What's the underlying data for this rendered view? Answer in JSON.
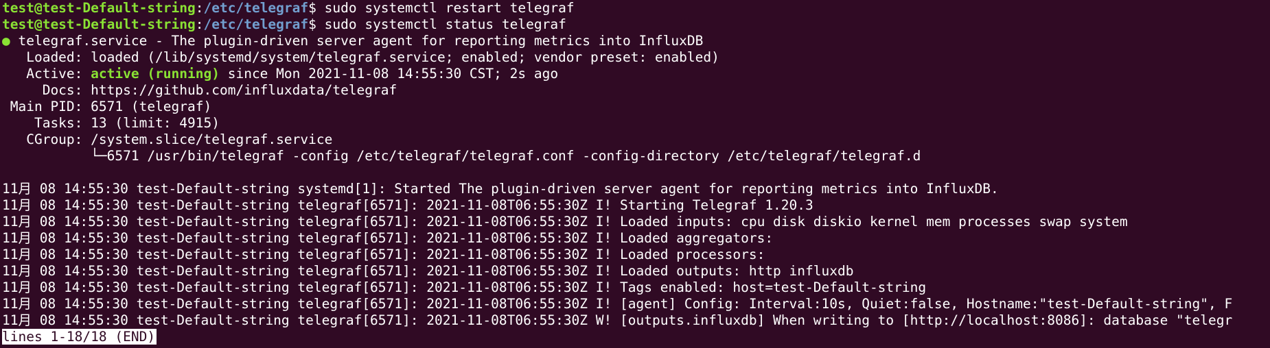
{
  "terminal": {
    "prompt_user": "test@test-Default-string",
    "prompt_sep": ":",
    "prompt_path": "/etc/telegraf",
    "prompt_symbol": "$ ",
    "commands": [
      "sudo systemctl restart telegraf",
      "sudo systemctl status telegraf"
    ],
    "status": {
      "bullet": "●",
      "header": " telegraf.service - The plugin-driven server agent for reporting metrics into InfluxDB",
      "loaded": "   Loaded: loaded (/lib/systemd/system/telegraf.service; enabled; vendor preset: enabled)",
      "active_label": "   Active: ",
      "active_state": "active (running)",
      "active_rest": " since Mon 2021-11-08 14:55:30 CST; 2s ago",
      "docs": "     Docs: https://github.com/influxdata/telegraf",
      "main_pid": " Main PID: 6571 (telegraf)",
      "tasks": "    Tasks: 13 (limit: 4915)",
      "cgroup": "   CGroup: /system.slice/telegraf.service",
      "cgroup_child": "           └─6571 /usr/bin/telegraf -config /etc/telegraf/telegraf.conf -config-directory /etc/telegraf/telegraf.d"
    },
    "log_lines": [
      "11月 08 14:55:30 test-Default-string systemd[1]: Started The plugin-driven server agent for reporting metrics into InfluxDB.",
      "11月 08 14:55:30 test-Default-string telegraf[6571]: 2021-11-08T06:55:30Z I! Starting Telegraf 1.20.3",
      "11月 08 14:55:30 test-Default-string telegraf[6571]: 2021-11-08T06:55:30Z I! Loaded inputs: cpu disk diskio kernel mem processes swap system",
      "11月 08 14:55:30 test-Default-string telegraf[6571]: 2021-11-08T06:55:30Z I! Loaded aggregators:",
      "11月 08 14:55:30 test-Default-string telegraf[6571]: 2021-11-08T06:55:30Z I! Loaded processors:",
      "11月 08 14:55:30 test-Default-string telegraf[6571]: 2021-11-08T06:55:30Z I! Loaded outputs: http influxdb",
      "11月 08 14:55:30 test-Default-string telegraf[6571]: 2021-11-08T06:55:30Z I! Tags enabled: host=test-Default-string",
      "11月 08 14:55:30 test-Default-string telegraf[6571]: 2021-11-08T06:55:30Z I! [agent] Config: Interval:10s, Quiet:false, Hostname:\"test-Default-string\", F",
      "11月 08 14:55:30 test-Default-string telegraf[6571]: 2021-11-08T06:55:30Z W! [outputs.influxdb] When writing to [http://localhost:8086]: database \"telegr"
    ],
    "pager_status": "lines 1-18/18 (END)",
    "colors": {
      "background": "#300a24",
      "foreground": "#ffffff",
      "prompt_user": "#8ae234",
      "prompt_path": "#729fcf",
      "active": "#8ae234"
    }
  }
}
